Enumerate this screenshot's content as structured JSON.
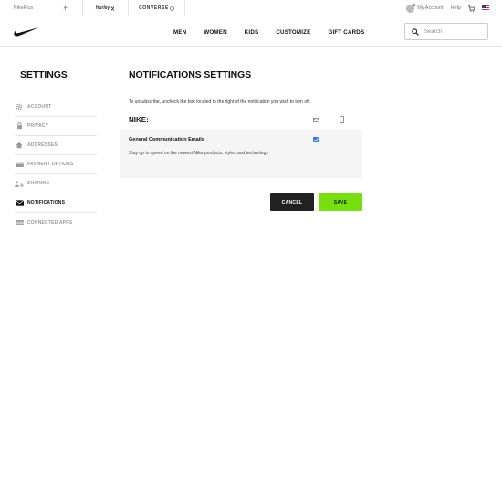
{
  "utility_bar": {
    "brands": [
      "NikePlus",
      "Hurley",
      "CONVERSE"
    ],
    "my_account": "My Account",
    "help": "Help"
  },
  "nav": {
    "links": [
      "MEN",
      "WOMEN",
      "KIDS",
      "CUSTOMIZE",
      "GIFT CARDS"
    ],
    "search_placeholder": "Search"
  },
  "sidebar": {
    "title": "SETTINGS",
    "items": [
      {
        "label": "ACCOUNT",
        "icon": "gear-icon",
        "active": false
      },
      {
        "label": "PRIVACY",
        "icon": "lock-icon",
        "active": false
      },
      {
        "label": "ADDRESSES",
        "icon": "house-icon",
        "active": false
      },
      {
        "label": "PAYMENT OPTIONS",
        "icon": "credit-card-icon",
        "active": false
      },
      {
        "label": "SHARING",
        "icon": "share-users-icon",
        "active": false
      },
      {
        "label": "NOTIFICATIONS",
        "icon": "envelope-icon",
        "active": true
      },
      {
        "label": "CONNECTED APPS",
        "icon": "apps-grid-icon",
        "active": false
      }
    ]
  },
  "main": {
    "title": "NOTIFICATIONS SETTINGS",
    "instruction": "To unsubscribe, uncheck the box located to the right of the notification you wish to turn off.",
    "section_label": "NIKE:",
    "channel_icons": [
      "mail-icon",
      "mobile-phone-icon"
    ],
    "preferences": [
      {
        "title": "General Communication Emails",
        "description": "Stay up to speed on the newest Nike products, styles and technology.",
        "email_checked": true
      }
    ],
    "cancel_label": "CANCEL",
    "save_label": "SAVE"
  },
  "colors": {
    "save_button": "#75e00b",
    "cancel_button": "#222222",
    "checkbox": "#2d7ce4",
    "panel_bg": "#f5f5f5"
  }
}
